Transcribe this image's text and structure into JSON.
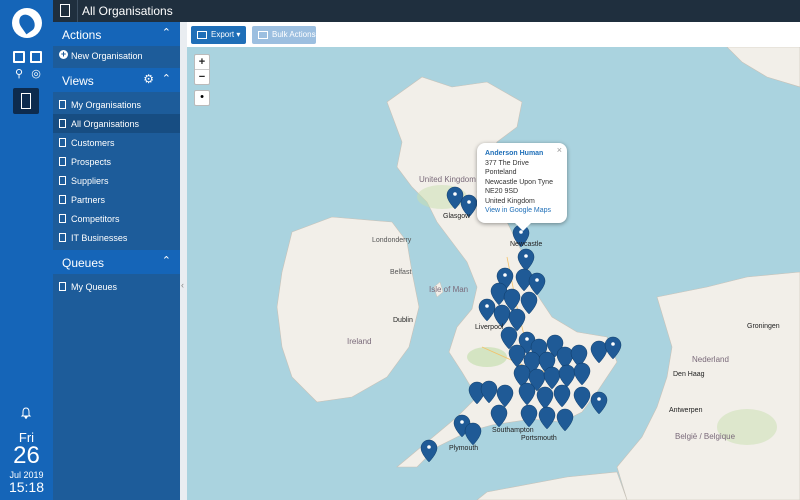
{
  "topbar": {
    "title": "All Organisations"
  },
  "rail": {
    "dow": "Fri",
    "day": "26",
    "month_year": "Jul 2019",
    "time": "15:18"
  },
  "sidebar": {
    "actions": {
      "heading": "Actions",
      "items": [
        {
          "label": "New Organisation",
          "icon": "plus-icon"
        }
      ]
    },
    "views": {
      "heading": "Views",
      "items": [
        {
          "label": "My Organisations"
        },
        {
          "label": "All Organisations",
          "selected": true
        },
        {
          "label": "Customers"
        },
        {
          "label": "Prospects"
        },
        {
          "label": "Suppliers"
        },
        {
          "label": "Partners"
        },
        {
          "label": "Competitors"
        },
        {
          "label": "IT Businesses"
        }
      ]
    },
    "queues": {
      "heading": "Queues",
      "items": [
        {
          "label": "My Queues"
        }
      ]
    }
  },
  "toolbar": {
    "export_label": "Export",
    "bulk_label": "Bulk Actions"
  },
  "map": {
    "labels": {
      "united_kingdom": "United Kingdom",
      "isle_of_man": "Isle of Man",
      "ireland": "Ireland",
      "glasgow": "Glasgow",
      "liverpool": "Liverpool",
      "dublin": "Dublin",
      "plymouth": "Plymouth",
      "southampton": "Southampton",
      "portsmouth": "Portsmouth",
      "newcastle": "Newcastle",
      "groningen": "Groningen",
      "nederland": "Nederland",
      "den_haag": "Den Haag",
      "antwerpen": "Antwerpen",
      "belgique": "België / Belgique",
      "londonderry": "Londonderry",
      "belfast": "Belfast"
    },
    "popup": {
      "name": "Anderson Human",
      "line1": "377 The Drive",
      "line2": "Ponteland",
      "line3": "Newcastle Upon Tyne",
      "line4": "NE20 9SD",
      "line5": "United Kingdom",
      "link": "View in Google Maps"
    },
    "zoom_in": "+",
    "zoom_out": "−",
    "locate": "•"
  },
  "colors": {
    "rail": "#1565b8",
    "sidebar": "#1d5c9a",
    "topbar": "#1f2f3e",
    "sea": "#aad3df",
    "land": "#f2efe9",
    "pin": "#1f5a96"
  }
}
